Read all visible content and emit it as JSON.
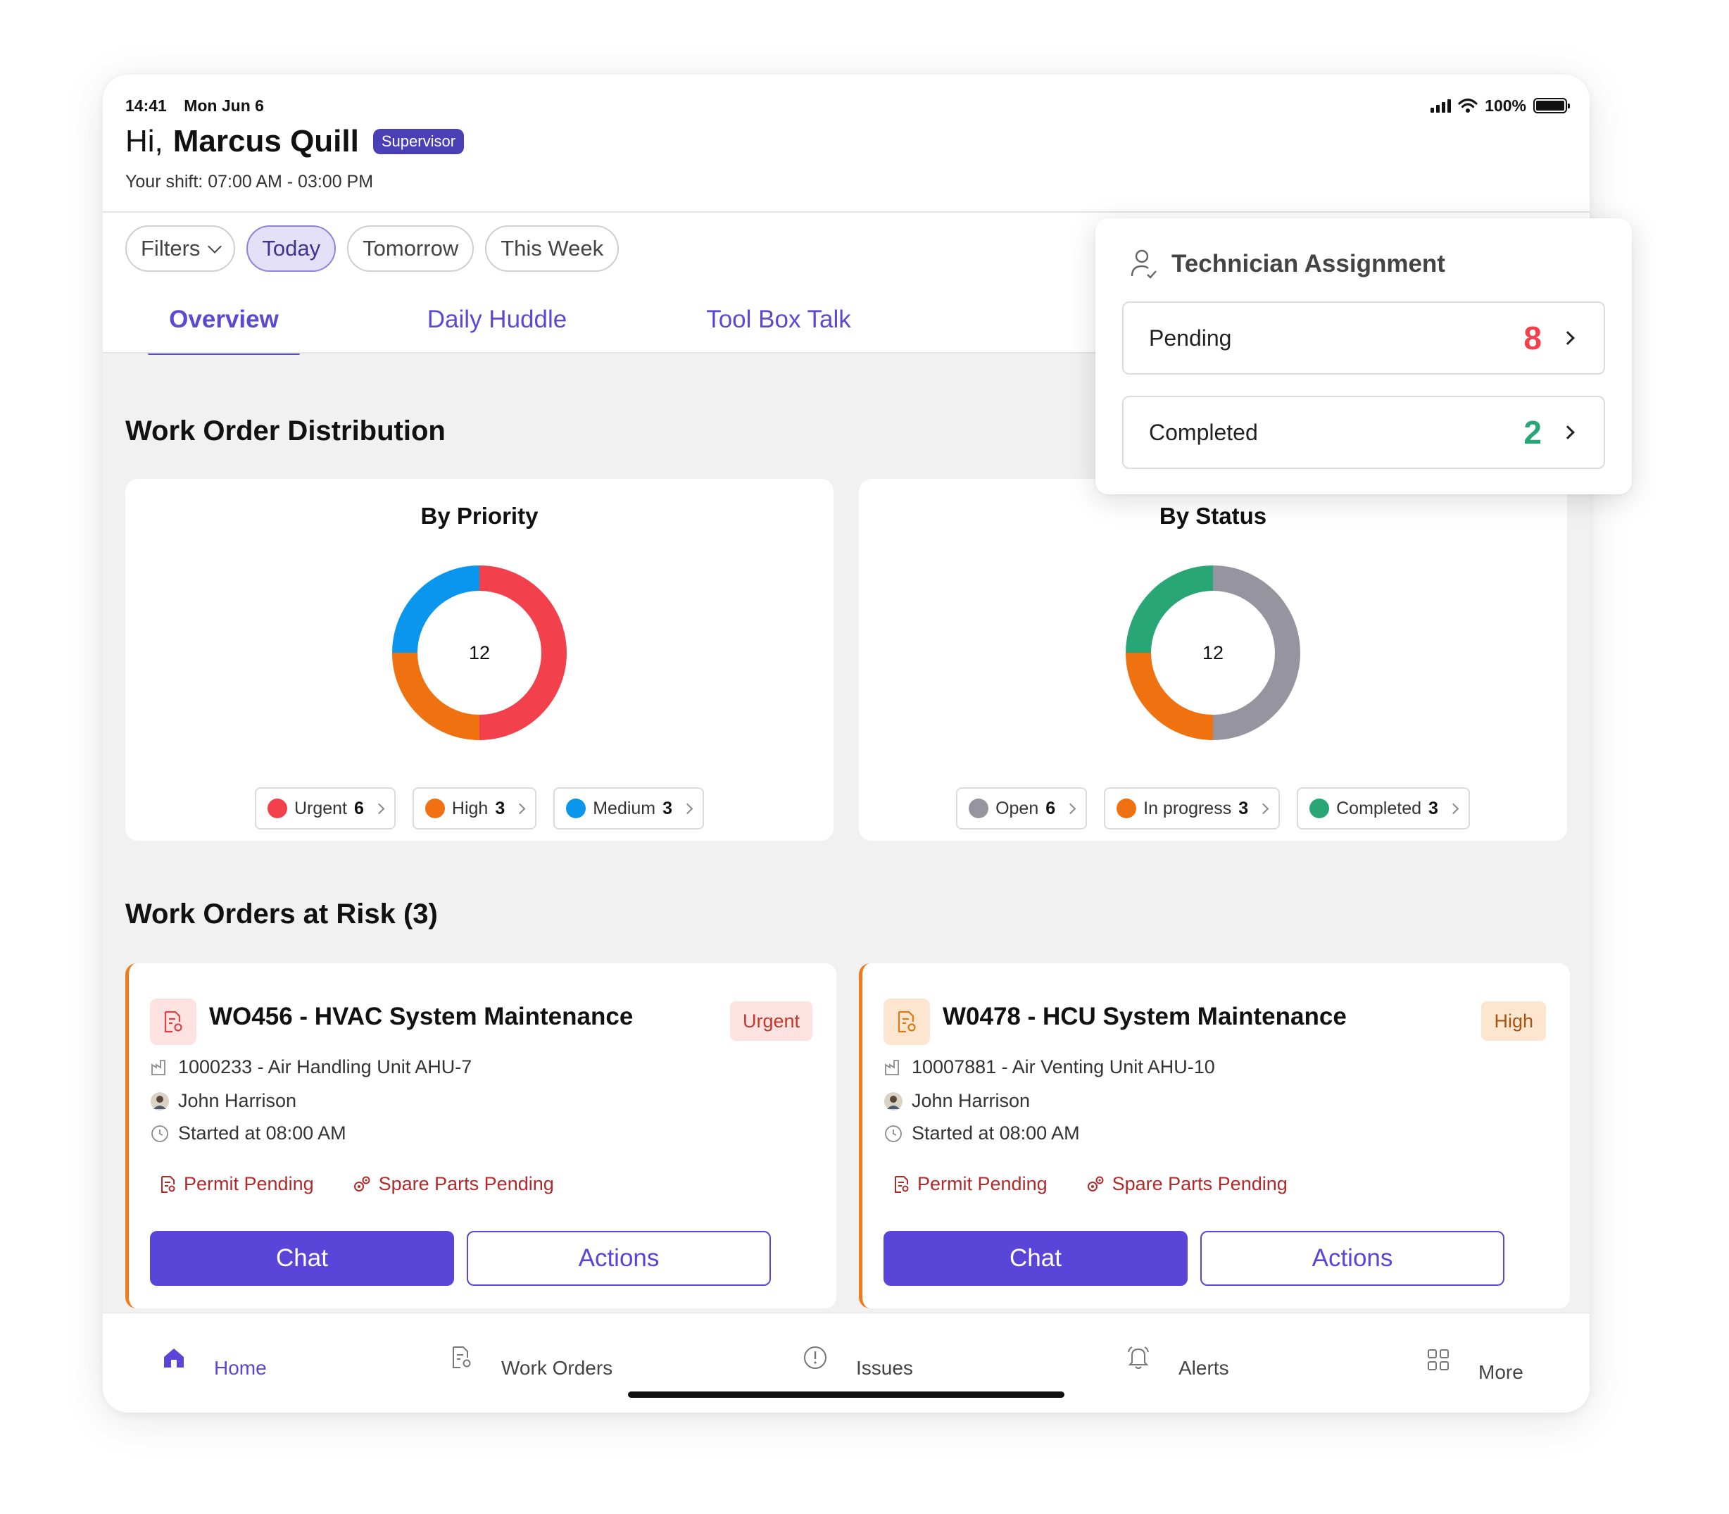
{
  "status_bar": {
    "time": "14:41",
    "date": "Mon Jun 6",
    "battery": "100%"
  },
  "header": {
    "greeting": "Hi,",
    "user_name": "Marcus Quill",
    "role": "Supervisor",
    "shift": "Your shift: 07:00 AM - 03:00 PM"
  },
  "filters": {
    "filters_label": "Filters",
    "today": "Today",
    "tomorrow": "Tomorrow",
    "this_week": "This Week"
  },
  "tabs": {
    "overview": "Overview",
    "daily_huddle": "Daily Huddle",
    "toolbox_talk": "Tool Box Talk"
  },
  "distribution": {
    "title": "Work Order Distribution",
    "by_priority": {
      "title": "By Priority",
      "total": "12",
      "legend": [
        {
          "label": "Urgent",
          "count": "6",
          "color": "#f2414d"
        },
        {
          "label": "High",
          "count": "3",
          "color": "#f07110"
        },
        {
          "label": "Medium",
          "count": "3",
          "color": "#0b96ee"
        }
      ]
    },
    "by_status": {
      "title": "By Status",
      "total": "12",
      "legend": [
        {
          "label": "Open",
          "count": "6",
          "color": "#96959f"
        },
        {
          "label": "In progress",
          "count": "3",
          "color": "#f07110"
        },
        {
          "label": "Completed",
          "count": "3",
          "color": "#29a676"
        }
      ]
    }
  },
  "chart_data": [
    {
      "type": "pie",
      "title": "By Priority",
      "categories": [
        "Urgent",
        "High",
        "Medium"
      ],
      "values": [
        6,
        3,
        3
      ],
      "center_label": "12"
    },
    {
      "type": "pie",
      "title": "By Status",
      "categories": [
        "Open",
        "In progress",
        "Completed"
      ],
      "values": [
        6,
        3,
        3
      ],
      "center_label": "12"
    }
  ],
  "at_risk": {
    "title": "Work Orders at Risk (3)",
    "orders": [
      {
        "title": "WO456 - HVAC System Maintenance",
        "priority": "Urgent",
        "asset": "1000233 - Air Handling Unit AHU-7",
        "assignee": "John Harrison",
        "started": "Started at 08:00 AM",
        "permit": "Permit Pending",
        "parts": "Spare Parts Pending",
        "chat": "Chat",
        "actions": "Actions"
      },
      {
        "title": "W0478 - HCU System Maintenance",
        "priority": "High",
        "asset": "10007881 - Air Venting Unit AHU-10",
        "assignee": "John Harrison",
        "started": "Started at 08:00 AM",
        "permit": "Permit Pending",
        "parts": "Spare Parts Pending",
        "chat": "Chat",
        "actions": "Actions"
      }
    ]
  },
  "technician_assignment": {
    "title": "Technician Assignment",
    "pending_label": "Pending",
    "pending_count": "8",
    "completed_label": "Completed",
    "completed_count": "2"
  },
  "bottom_nav": {
    "home": "Home",
    "work_orders": "Work Orders",
    "issues": "Issues",
    "alerts": "Alerts",
    "more": "More"
  },
  "colors": {
    "accent": "#5a45d9",
    "urgent": "#f2414d",
    "high": "#f07110",
    "medium": "#0b96ee",
    "open": "#96959f",
    "completed": "#29a676",
    "risk_border": "#f07a1a"
  }
}
